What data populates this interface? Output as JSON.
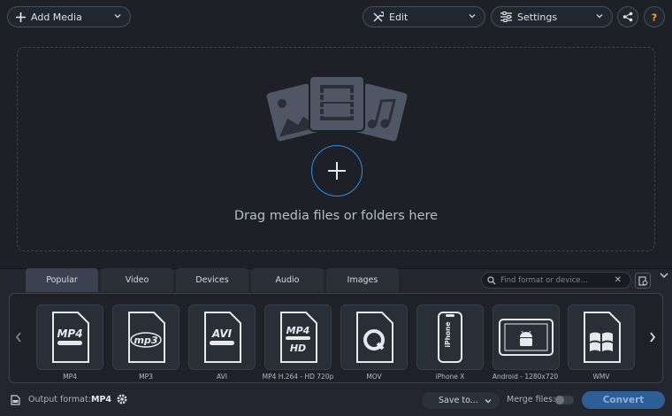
{
  "toolbar": {
    "add_media": "Add Media",
    "edit": "Edit",
    "settings": "Settings",
    "share_icon": "share-icon",
    "help_icon": "question-icon",
    "accent": "#f2b01e"
  },
  "dropzone": {
    "text": "Drag media files or folders here",
    "accent": "#2b8fe6"
  },
  "tabs": [
    {
      "label": "Popular",
      "active": true
    },
    {
      "label": "Video",
      "active": false
    },
    {
      "label": "Devices",
      "active": false
    },
    {
      "label": "Audio",
      "active": false
    },
    {
      "label": "Images",
      "active": false
    }
  ],
  "search": {
    "placeholder": "Find format or device..."
  },
  "formats": [
    {
      "label": "MP4",
      "icon": "mp4-icon"
    },
    {
      "label": "MP3",
      "icon": "mp3-icon"
    },
    {
      "label": "AVI",
      "icon": "avi-icon"
    },
    {
      "label": "MP4 H.264 - HD 720p",
      "icon": "mp4-hd-icon"
    },
    {
      "label": "MOV",
      "icon": "quicktime-icon"
    },
    {
      "label": "iPhone X",
      "icon": "iphone-icon"
    },
    {
      "label": "Android - 1280x720",
      "icon": "android-tablet-icon"
    },
    {
      "label": "WMV",
      "icon": "windows-icon"
    }
  ],
  "status": {
    "output_format_label": "Output format:",
    "output_format_value": "MP4",
    "save_to": "Save to...",
    "merge_files": "Merge files:",
    "convert": "Convert",
    "convert_color": "#2e5e96"
  }
}
